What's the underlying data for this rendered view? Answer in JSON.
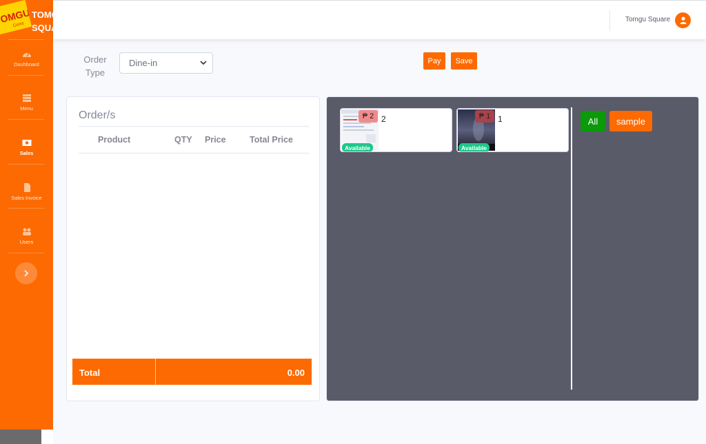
{
  "brand": {
    "logo_text": "TOMGU",
    "logo_subtext": "Corns",
    "name_line1": "TOMGU",
    "name_line2": "SQUARE"
  },
  "sidebar": {
    "items": [
      {
        "label": "Dashboard",
        "icon": "tachometer-icon",
        "active": false
      },
      {
        "label": "Menu",
        "icon": "list-icon",
        "active": false
      },
      {
        "label": "Sales",
        "icon": "money-bill-icon",
        "active": true
      },
      {
        "label": "Sales Invoice",
        "icon": "file-icon",
        "active": false
      },
      {
        "label": "Users",
        "icon": "users-icon",
        "active": false
      }
    ],
    "toggle_icon": "chevron-right-icon"
  },
  "topbar": {
    "user_name": "Tomgu Square",
    "avatar_icon": "user-icon"
  },
  "order_type": {
    "label": "Order Type",
    "selected": "Dine-in"
  },
  "actions": {
    "pay_label": "Pay",
    "save_label": "Save"
  },
  "orders": {
    "title": "Order/s",
    "columns": [
      "Product",
      "QTY",
      "Price",
      "Total Price"
    ],
    "rows": [],
    "total_label": "Total",
    "total_value": "0.00"
  },
  "products": [
    {
      "name": "2",
      "price": "₱ 2",
      "status": "Available"
    },
    {
      "name": "1",
      "price": "₱ 1",
      "status": "Available"
    }
  ],
  "categories": [
    {
      "label": "All",
      "color": "#0a9a0a"
    },
    {
      "label": "sample",
      "color": "#fd6a02"
    }
  ],
  "colors": {
    "accent": "#fd6a02",
    "panel": "#5a5b69",
    "available": "#1cc88a"
  }
}
